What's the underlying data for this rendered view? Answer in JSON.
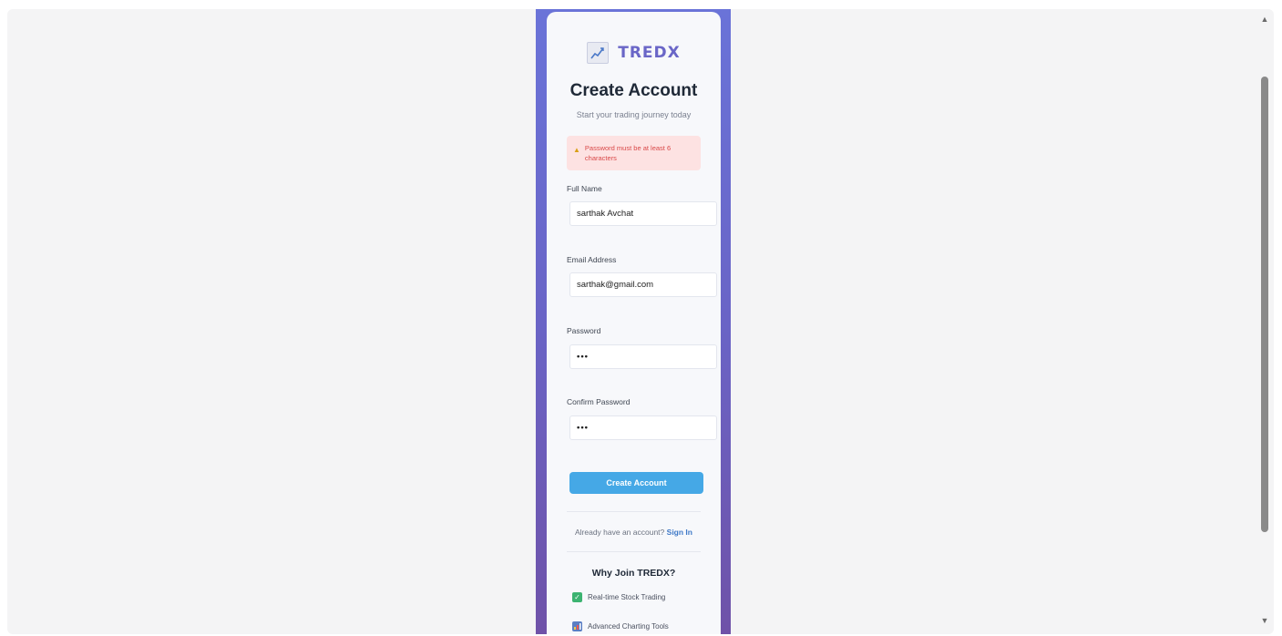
{
  "logo": {
    "text": "TREDX",
    "icon": "chart-line-icon"
  },
  "header": {
    "title": "Create Account",
    "subtitle": "Start your trading journey today"
  },
  "alert": {
    "icon": "warning-icon",
    "message": "Password must be at least 6 characters"
  },
  "form": {
    "full_name": {
      "label": "Full Name",
      "value": "sarthak Avchat"
    },
    "email": {
      "label": "Email Address",
      "value": "sarthak@gmail.com"
    },
    "password": {
      "label": "Password",
      "value": "•••"
    },
    "confirm_password": {
      "label": "Confirm Password",
      "value": "•••"
    },
    "submit_label": "Create Account"
  },
  "signin": {
    "prompt": "Already have an account?",
    "link": "Sign In"
  },
  "benefits": {
    "title": "Why Join TREDX?",
    "items": [
      {
        "icon": "check-icon",
        "label": "Real-time Stock Trading"
      },
      {
        "icon": "bar-chart-icon",
        "label": "Advanced Charting Tools"
      }
    ]
  },
  "colors": {
    "accent": "#6a66c7",
    "button": "#45a8e6",
    "error_bg": "#fde2e2",
    "error_text": "#d94848"
  }
}
